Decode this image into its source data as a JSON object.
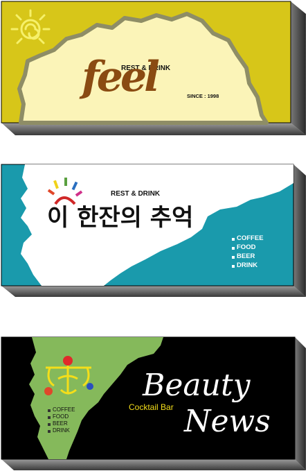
{
  "signs": [
    {
      "tag": "REST & DRINK",
      "name": "feel",
      "since": "SINCE : 1998",
      "colors": {
        "panel": "#d7c619",
        "cloud": "#fbf4b8",
        "border": "#8e8d66"
      },
      "icon": "sun-icon"
    },
    {
      "tag": "REST & DRINK",
      "name": "이 한잔의 추억",
      "menu": [
        "COFFEE",
        "FOOD",
        "BEER",
        "DRINK"
      ],
      "colors": {
        "panel": "#1a9aac",
        "cloud": "#ffffff"
      },
      "icon": "colorful-pinwheel-icon"
    },
    {
      "subtitle": "Cocktail Bar",
      "title_line1": "Beauty",
      "title_line2": "News",
      "menu": [
        "COFFEE",
        "FOOD",
        "BEER",
        "DRINK"
      ],
      "colors": {
        "panel": "#000000",
        "green": "#85b95b",
        "accent": "#f4de1a"
      },
      "icon": "abstract-figure-logo-icon"
    }
  ]
}
